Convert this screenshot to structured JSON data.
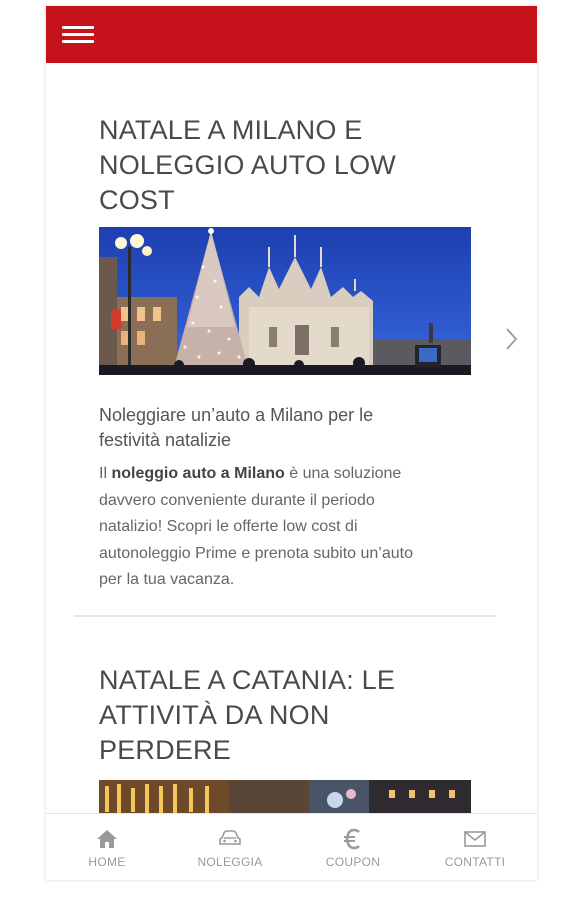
{
  "articles": [
    {
      "title_lines": [
        "NATALE A MILANO E",
        "NOLEGGIO AUTO LOW",
        "COST"
      ],
      "subtitle_lines": [
        "Noleggiare un’auto a Milano per le",
        "festività natalizie"
      ],
      "body": {
        "prefix": "Il ",
        "bold": "noleggio auto a Milano",
        "line1_rest": " è una soluzione",
        "line2": "davvero conveniente durante il periodo",
        "line3": "natalizio! Scopri le offerte low cost di",
        "line4": "autonoleggio Prime e prenota subito un’auto",
        "line5": "per la tua vacanza."
      }
    },
    {
      "title_lines": [
        "NATALE A CATANIA: LE",
        "ATTIVITÀ DA NON",
        "PERDERE"
      ]
    }
  ],
  "bottom_nav": [
    {
      "label": "HOME",
      "icon": "home-icon"
    },
    {
      "label": "NOLEGGIA",
      "icon": "car-icon"
    },
    {
      "label": "COUPON",
      "icon": "euro-icon"
    },
    {
      "label": "CONTATTI",
      "icon": "mail-icon"
    }
  ],
  "colors": {
    "header": "#c6131b",
    "title_text": "#4a4a4a",
    "nav_icon": "#9a9a9a"
  }
}
